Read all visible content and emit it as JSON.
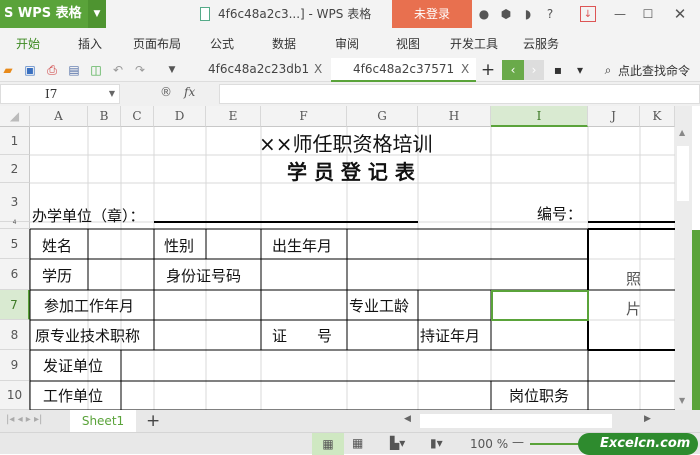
{
  "app": {
    "logo": "S WPS 表格",
    "title": "4f6c48a2c3...] - WPS 表格",
    "login": "未登录",
    "help": "?"
  },
  "menu": [
    "开始",
    "插入",
    "页面布局",
    "公式",
    "数据",
    "审阅",
    "视图",
    "开发工具",
    "云服务"
  ],
  "doc_tabs": [
    {
      "label": "4f6c48a2c23db1",
      "close": "X"
    },
    {
      "label": "4f6c48a2c37571",
      "close": "X"
    }
  ],
  "search_command": "点此查找命令",
  "formula_bar": {
    "cell_ref": "I7",
    "fx": "fx",
    "value": ""
  },
  "columns": [
    "A",
    "B",
    "C",
    "D",
    "E",
    "F",
    "G",
    "H",
    "I",
    "J",
    "K"
  ],
  "rows": [
    "1",
    "2",
    "3",
    "4",
    "5",
    "6",
    "7",
    "8",
    "9",
    "10"
  ],
  "sheet": {
    "title": "××师任职资格培训",
    "subtitle": "学 员 登 记 表",
    "school_label": "办学单位（章）：",
    "number_label": "编号：",
    "name": "姓名",
    "gender": "性别",
    "birth": "出生年月",
    "education": "学历",
    "id_number": "身份证号码",
    "photo1": "照",
    "photo2": "片",
    "work_start": "参加工作年月",
    "pro_years": "专业工龄",
    "orig_title": "原专业技术职称",
    "cert_no": "证　　号",
    "cert_date": "持证年月",
    "issuer": "发证单位",
    "workplace": "工作单位",
    "position": "岗位职务"
  },
  "sheet_tabs": [
    "Sheet1"
  ],
  "add_sheet": "+",
  "status": {
    "zoom": "100 %",
    "watermark": "Excelcn.com"
  },
  "colors": {
    "accent": "#5aa33a",
    "login": "#e8704f"
  }
}
